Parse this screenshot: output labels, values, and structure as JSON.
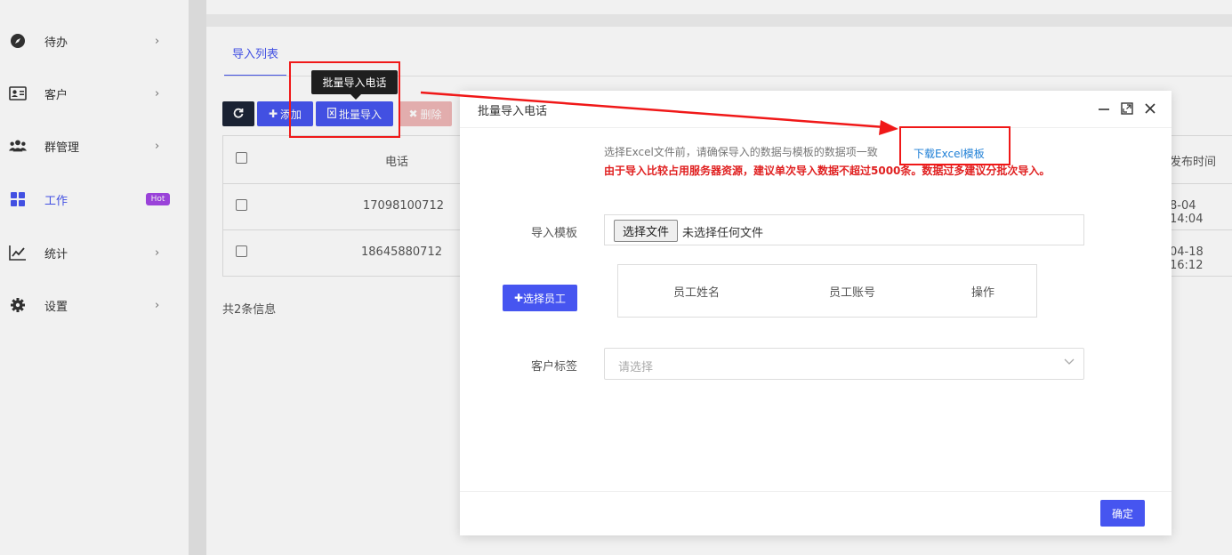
{
  "sidebar": {
    "items": [
      {
        "label": "待办",
        "icon": "compass-icon",
        "has_chevron": true
      },
      {
        "label": "客户",
        "icon": "id-card-icon",
        "has_chevron": true
      },
      {
        "label": "群管理",
        "icon": "users-icon",
        "has_chevron": true
      },
      {
        "label": "工作",
        "icon": "grid-icon",
        "badge": "Hot",
        "active": true
      },
      {
        "label": "统计",
        "icon": "chart-line-icon",
        "has_chevron": true
      },
      {
        "label": "设置",
        "icon": "gear-icon",
        "has_chevron": true
      }
    ],
    "chevron": "›"
  },
  "tabs": [
    "导入列表"
  ],
  "toolbar": {
    "refresh_icon": "refresh-icon",
    "add_label": "添加",
    "import_label": "批量导入",
    "delete_label": "删除"
  },
  "tooltip": "批量导入电话",
  "table": {
    "columns": [
      "电话",
      "发布时间"
    ],
    "rows": [
      {
        "phone": "17098100712",
        "time": "8-04 14:04"
      },
      {
        "phone": "18645880712",
        "time": "04-18 16:12"
      }
    ],
    "total": "共2条信息"
  },
  "modal": {
    "title": "批量导入电话",
    "notice": "选择Excel文件前，请确保导入的数据与模板的数据项一致",
    "download_link": "下载Excel模板",
    "warning": "由于导入比较占用服务器资源，建议单次导入数据不超过5000条。数据过多建议分批次导入。",
    "template_label": "导入模板",
    "file_button": "选择文件",
    "file_status": "未选择任何文件",
    "staff_button": "选择员工",
    "staff_columns": [
      "员工姓名",
      "员工账号",
      "操作"
    ],
    "tag_label": "客户标签",
    "tag_placeholder": "请选择",
    "confirm_label": "确定"
  },
  "colors": {
    "primary": "#4655f0",
    "danger_text": "#e02020",
    "annotation": "#f01818",
    "hot_badge": "#a346e6"
  }
}
